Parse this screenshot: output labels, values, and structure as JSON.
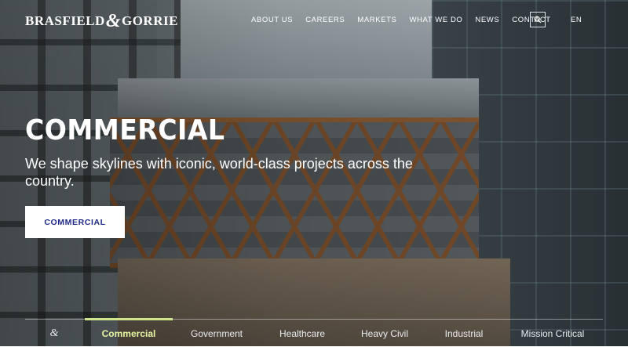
{
  "logo": {
    "left": "BRASFIELD",
    "amp": "&",
    "right": "GORRIE"
  },
  "nav": {
    "items": [
      "ABOUT US",
      "CAREERS",
      "MARKETS",
      "WHAT WE DO",
      "NEWS",
      "CONTACT"
    ],
    "search_icon": "search-icon",
    "language": "EN"
  },
  "hero": {
    "title": "COMMERCIAL",
    "subtitle": "We shape skylines with iconic, world-class projects across the country.",
    "button_label": "COMMERCIAL"
  },
  "tabs": {
    "home_icon": "&",
    "items": [
      "Commercial",
      "Government",
      "Healthcare",
      "Heavy Civil",
      "Industrial",
      "Mission Critical"
    ],
    "active": "Commercial"
  },
  "colors": {
    "accent_active_tab": "#cfe58a",
    "button_text": "#1f2b8a",
    "button_bg": "#ffffff"
  }
}
